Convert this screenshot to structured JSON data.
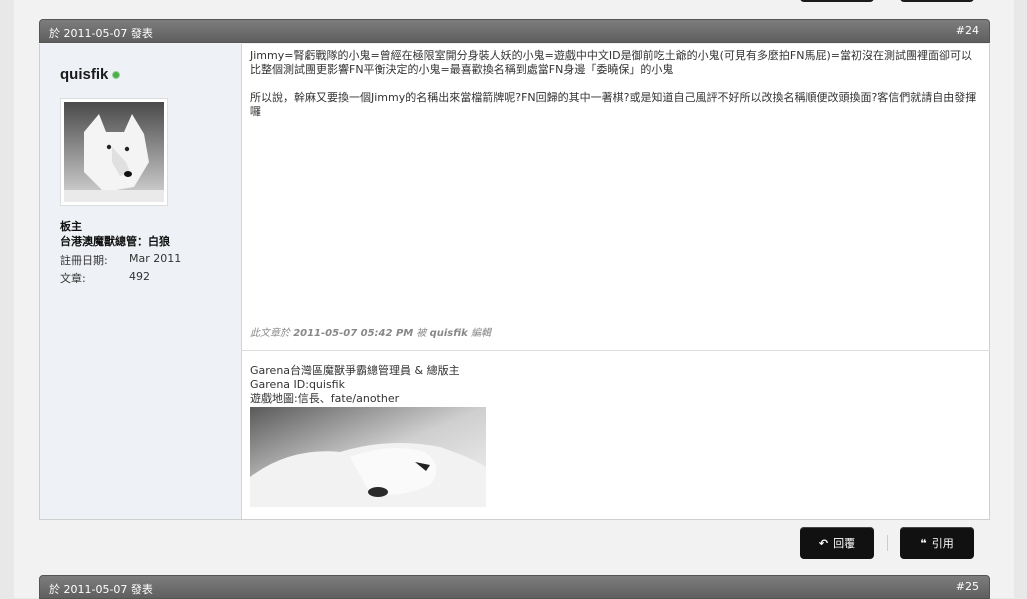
{
  "post": {
    "date": "於 2011-05-07 發表",
    "number": "#24",
    "user": {
      "name": "quisfik",
      "rank1": "板主",
      "rank2": "台港澳魔獸總管：白狼",
      "join_label": "註冊日期:",
      "join_value": "Mar 2011",
      "posts_label": "文章:",
      "posts_value": "492"
    },
    "content": {
      "para1": "Jimmy=腎虧戰隊的小鬼=曾經在極限室開分身裝人妖的小鬼=遊戲中中文ID是御前吃土爺的小鬼(可見有多麼拍FN馬屁)=當初沒在測試團裡面卻可以比整個測試團更影響FN平衡決定的小鬼=最喜歡換名稱到處當FN身邊「委曉保」的小鬼",
      "para2": "所以說，幹麻又要換一個Jimmy的名稱出來當檔箭牌呢?FN回歸的其中一著棋?或是知道自己風評不好所以改換名稱順便改頭換面?客信們就請自由發揮囉"
    },
    "edited": {
      "prefix": "此文章於 ",
      "time": "2011-05-07 05:42 PM",
      "mid": " 被 ",
      "by": "quisfik",
      "suffix": " 編輯"
    },
    "signature": {
      "line1": "Garena台灣區魔獸爭霸總管理員 & 總版主",
      "line2": "Garena ID:quisfik",
      "line3": "遊戲地圖:信長、fate/another"
    },
    "actions": {
      "reply": "回覆",
      "quote": "引用"
    }
  },
  "next_post": {
    "date": "於 2011-05-07 發表",
    "number": "#25"
  },
  "icons": {
    "reply": "reply-arrow-icon",
    "quote": "quote-marks-icon",
    "online": "online-status-icon"
  },
  "colors": {
    "header_bg": "#6e6e6e",
    "button_bg": "#111111",
    "userinfo_bg": "#eef2f6",
    "online": "#4cae4c"
  }
}
